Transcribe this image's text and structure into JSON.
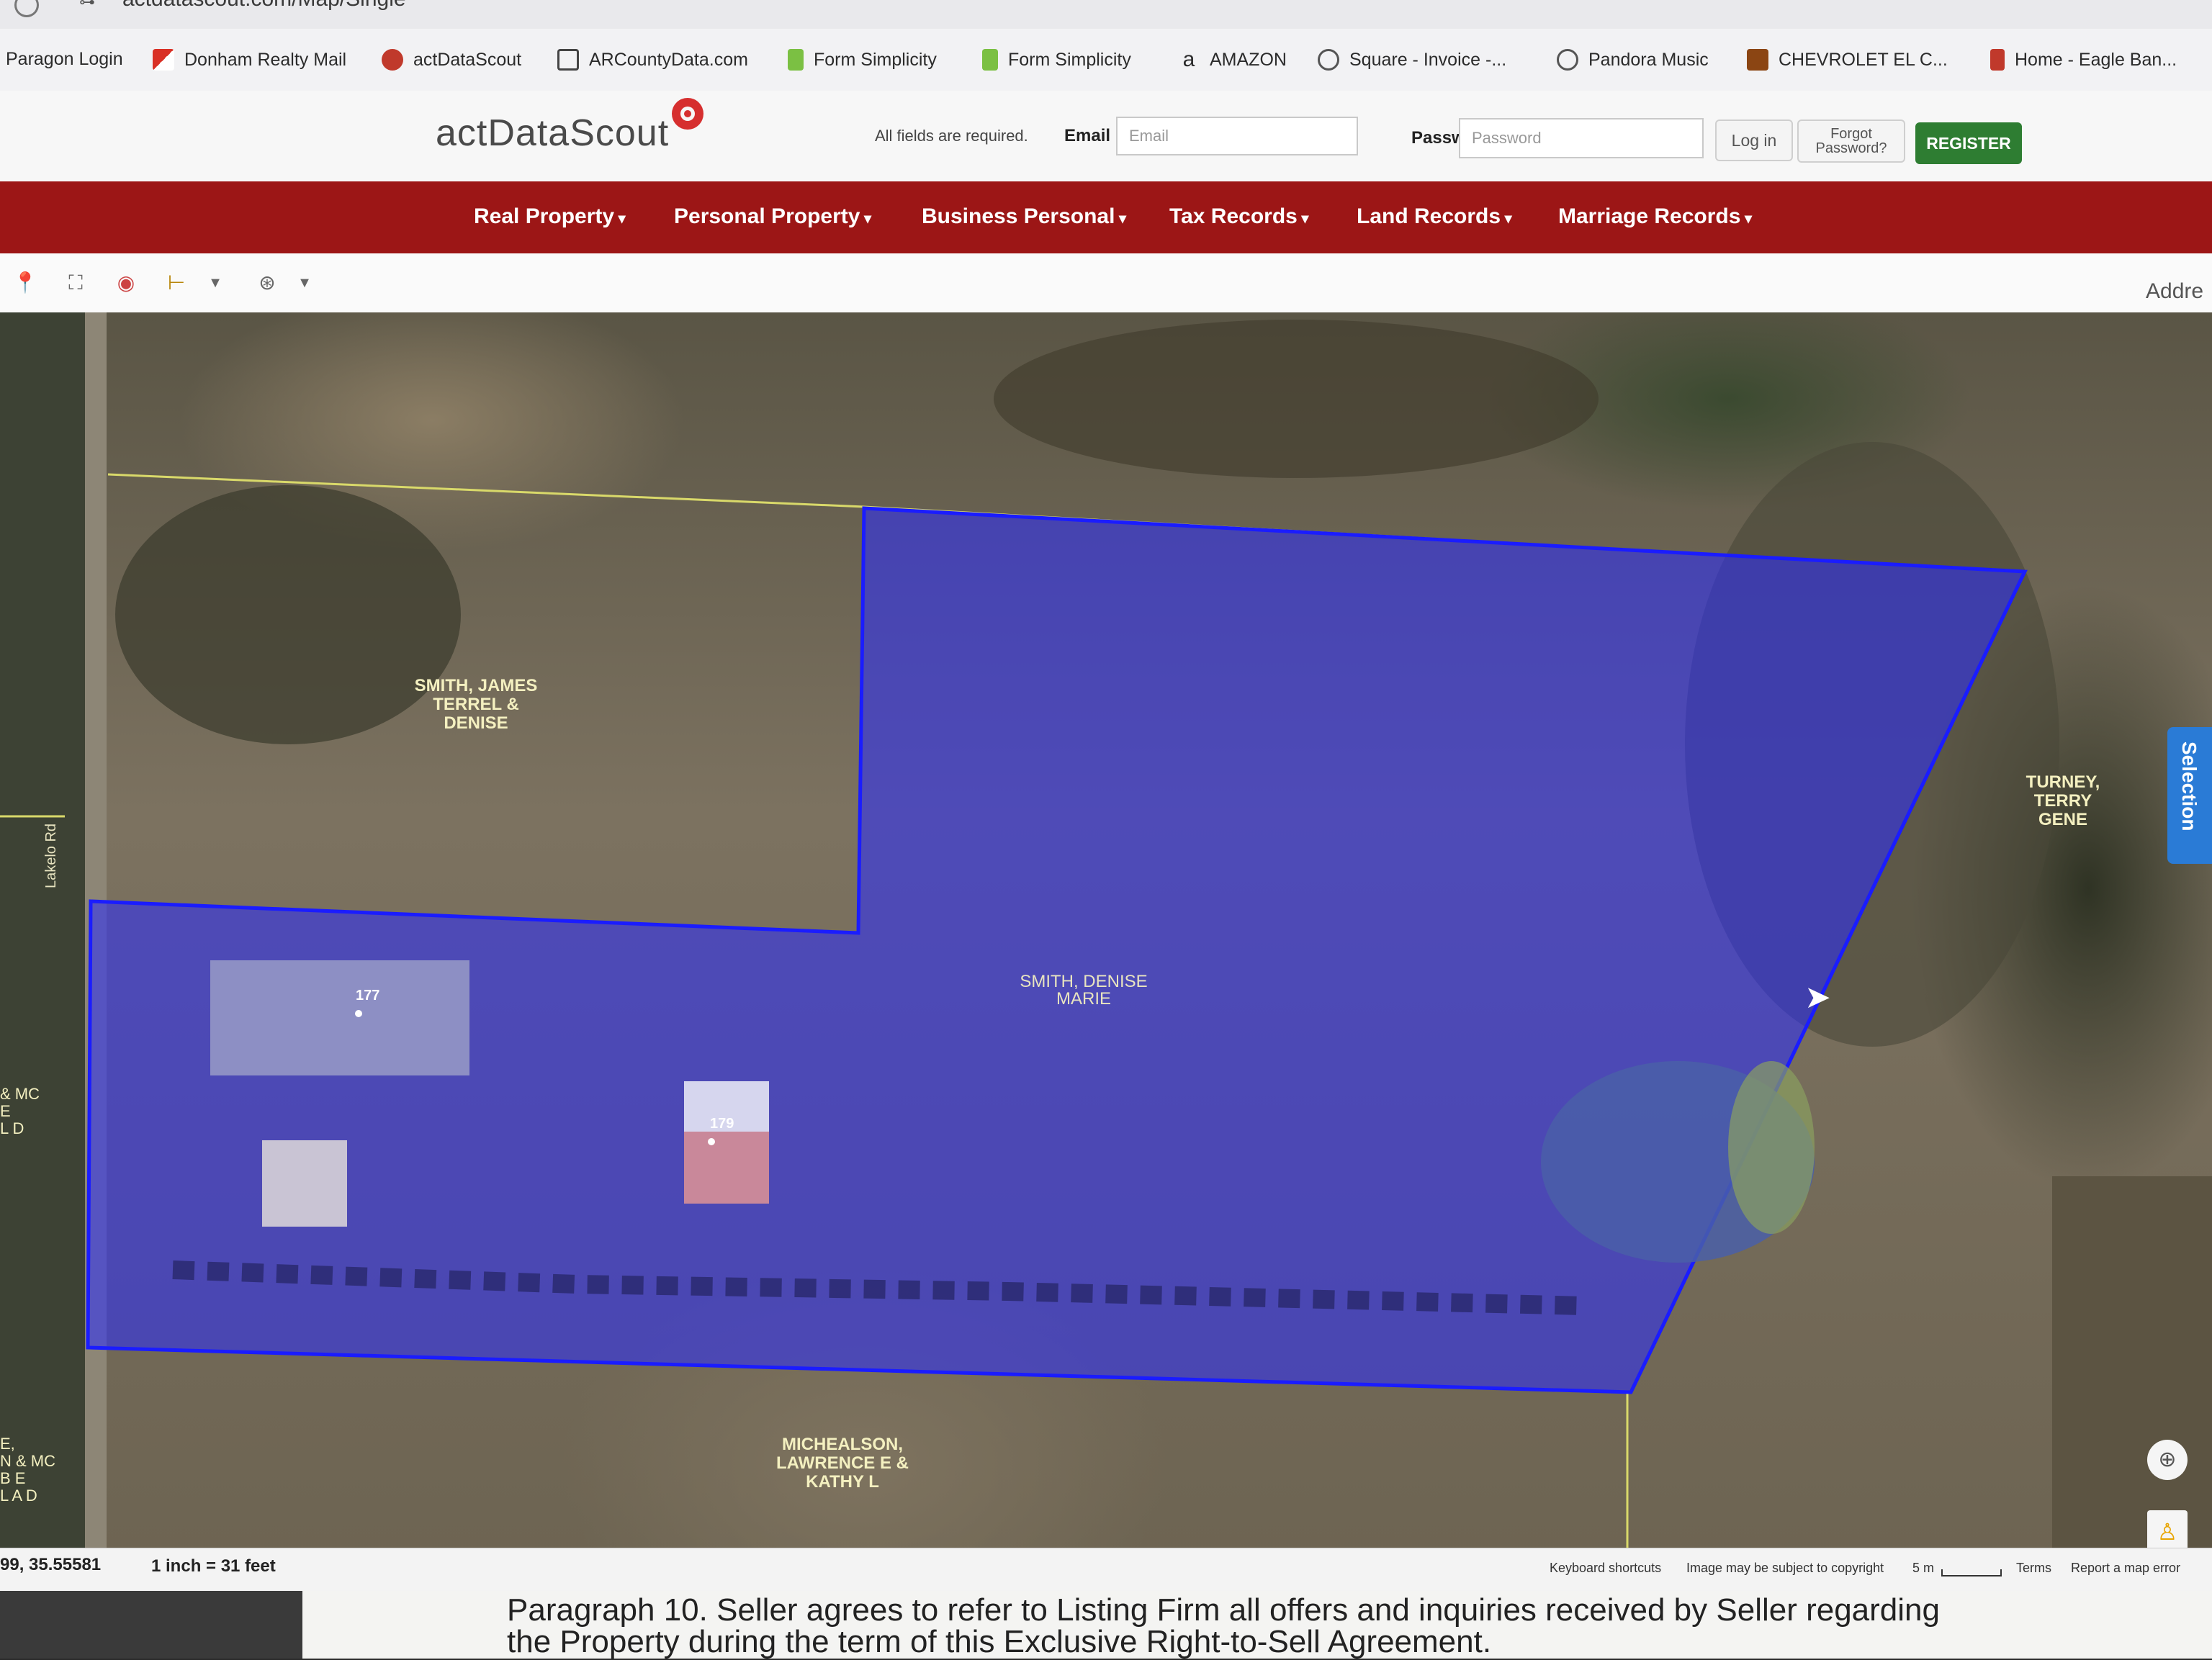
{
  "browser": {
    "url": "actdatascout.com/Map/Single",
    "bookmarks": [
      {
        "label": "Paragon Login",
        "icon": "none"
      },
      {
        "label": "Donham Realty Mail",
        "icon": "gmail-icon"
      },
      {
        "label": "actDataScout",
        "icon": "actdatascout-icon"
      },
      {
        "label": "ARCountyData.com",
        "icon": "arcountydata-icon"
      },
      {
        "label": "Form Simplicity",
        "icon": "document-icon"
      },
      {
        "label": "Form Simplicity",
        "icon": "document-icon"
      },
      {
        "label": "AMAZON",
        "icon": "amazon-icon"
      },
      {
        "label": "Square - Invoice -...",
        "icon": "globe-icon"
      },
      {
        "label": "Pandora Music",
        "icon": "globe-icon"
      },
      {
        "label": "CHEVROLET EL C...",
        "icon": "chevrolet-icon"
      },
      {
        "label": "Home - Eagle Ban...",
        "icon": "eagle-icon"
      }
    ]
  },
  "header": {
    "logo": "actDataScout",
    "required_note": "All fields are required.",
    "email_label": "Email",
    "email_placeholder": "Email",
    "password_label": "Password",
    "password_placeholder": "Password",
    "login_button": "Log in",
    "forgot_button": "Forgot Password?",
    "register_button": "REGISTER",
    "brand_color": "#9c1616",
    "register_color": "#2e7d32"
  },
  "nav": {
    "items": [
      "Real Property",
      "Personal Property",
      "Business Personal",
      "Tax Records",
      "Land Records",
      "Marriage Records"
    ]
  },
  "map_toolbar": {
    "tools": [
      "pin-icon",
      "fullscreen-icon",
      "eraser-icon",
      "measure-icon",
      "dropdown-icon",
      "layers-icon",
      "dropdown-icon"
    ],
    "address_hint": "Addre"
  },
  "map": {
    "parcel_highlight_color": "#2a2cff",
    "owner_labels": [
      {
        "text": "SMITH, JAMES\nTERREL &\nDENISE"
      },
      {
        "text": "TURNEY,\nTERRY GENE"
      },
      {
        "text": "SMITH, DENISE\nMARIE"
      },
      {
        "text": "MICHEALSON,\nLAWRENCE E &\nKATHY L"
      }
    ],
    "address_numbers": [
      "177",
      "179"
    ],
    "road_label": "Lakelo Rd",
    "edge_labels": [
      "& MC\nE\nL D",
      "E,\nN & MC\nB E\nL A D"
    ],
    "side_tab": "Selection",
    "coordinates": "99, 35.55581",
    "scale_text": "1 inch = 31 feet",
    "attribution": {
      "keyboard": "Keyboard shortcuts",
      "copyright": "Image may be subject to copyright",
      "scale": "5 m",
      "terms": "Terms",
      "report": "Report a map error"
    }
  },
  "paper": {
    "line1": "Paragraph 10. Seller agrees to refer to Listing Firm all offers and inquiries received by Seller regarding",
    "line2": "the Property during the term of this Exclusive Right-to-Sell Agreement."
  }
}
